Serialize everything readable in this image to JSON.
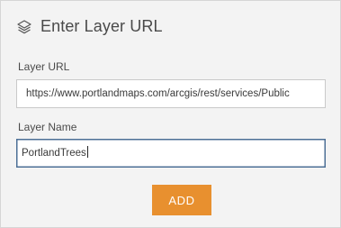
{
  "dialog": {
    "icon": "layers-icon",
    "title": "Enter Layer URL"
  },
  "url_field": {
    "label": "Layer URL",
    "value": "https://www.portlandmaps.com/arcgis/rest/services/Public"
  },
  "name_field": {
    "label": "Layer Name",
    "value": "PortlandTrees"
  },
  "actions": {
    "add_label": "ADD",
    "add_color": "#e8902f"
  }
}
